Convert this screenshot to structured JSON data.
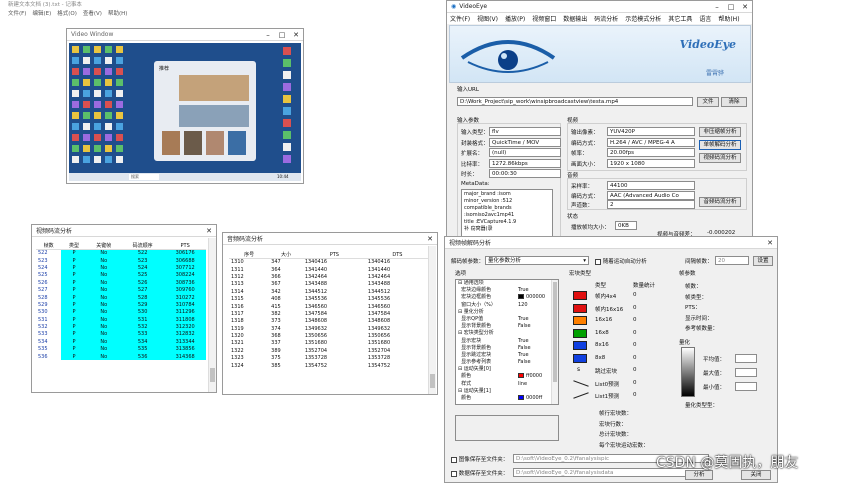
{
  "notepad": {
    "title": "新建文本文档 (3).txt - 记事本",
    "menus": [
      "文件(F)",
      "编辑(E)",
      "格式(O)",
      "查看(V)",
      "帮助(H)"
    ]
  },
  "video_window": {
    "title": "Video Window",
    "desktop_panel_title": "推荐",
    "taskbar_search": "搜索",
    "time": "10:44"
  },
  "stream_window": {
    "title": "视频码流分析",
    "headers": [
      "帧数",
      "类型",
      "关键帧",
      "码流顺序",
      "PTS"
    ],
    "rows": [
      [
        "522",
        "P",
        "No",
        "522",
        "306176"
      ],
      [
        "523",
        "P",
        "No",
        "523",
        "306688"
      ],
      [
        "524",
        "P",
        "No",
        "524",
        "307712"
      ],
      [
        "525",
        "P",
        "No",
        "525",
        "308224"
      ],
      [
        "526",
        "P",
        "No",
        "526",
        "308736"
      ],
      [
        "527",
        "P",
        "No",
        "527",
        "309760"
      ],
      [
        "528",
        "P",
        "No",
        "528",
        "310272"
      ],
      [
        "529",
        "P",
        "No",
        "529",
        "310784"
      ],
      [
        "530",
        "P",
        "No",
        "530",
        "311296"
      ],
      [
        "531",
        "P",
        "No",
        "531",
        "311808"
      ],
      [
        "532",
        "P",
        "No",
        "532",
        "312320"
      ],
      [
        "533",
        "P",
        "No",
        "533",
        "312832"
      ],
      [
        "534",
        "P",
        "No",
        "534",
        "313344"
      ],
      [
        "535",
        "P",
        "No",
        "535",
        "313856"
      ],
      [
        "536",
        "P",
        "No",
        "536",
        "314368"
      ]
    ]
  },
  "audio_window": {
    "title": "音频码流分析",
    "headers": [
      "序号",
      "大小",
      "PTS",
      "DTS"
    ],
    "rows": [
      [
        "1310",
        "347",
        "1340416",
        "1340416"
      ],
      [
        "1311",
        "364",
        "1341440",
        "1341440"
      ],
      [
        "1312",
        "366",
        "1342464",
        "1342464"
      ],
      [
        "1313",
        "367",
        "1343488",
        "1343488"
      ],
      [
        "1314",
        "342",
        "1344512",
        "1344512"
      ],
      [
        "1315",
        "408",
        "1345536",
        "1345536"
      ],
      [
        "1316",
        "415",
        "1346560",
        "1346560"
      ],
      [
        "1317",
        "382",
        "1347584",
        "1347584"
      ],
      [
        "1318",
        "373",
        "1348608",
        "1348608"
      ],
      [
        "1319",
        "374",
        "1349632",
        "1349632"
      ],
      [
        "1320",
        "368",
        "1350656",
        "1350656"
      ],
      [
        "1321",
        "337",
        "1351680",
        "1351680"
      ],
      [
        "1322",
        "389",
        "1352704",
        "1352704"
      ],
      [
        "1323",
        "375",
        "1353728",
        "1353728"
      ],
      [
        "1324",
        "385",
        "1354752",
        "1354752"
      ]
    ]
  },
  "videoeye": {
    "title": "VideoEye",
    "menus": [
      "文件(F)",
      "视图(V)",
      "播放(P)",
      "视频窗口",
      "数据输出",
      "码流分析",
      "示范模式分析",
      "其它工具",
      "语言",
      "帮助(H)"
    ],
    "brand": "VideoEye",
    "author": "雷霄骅",
    "url_label": "输入URL",
    "url_value": "D:\\Work_Project\\sip_work\\winsipbroadcastview\\testa.mp4",
    "file_btn": "文件",
    "clear_btn": "清除",
    "input_params_label": "输入参数",
    "input_fields": [
      {
        "label": "输入类型：",
        "value": "flv"
      },
      {
        "label": "封装格式：",
        "value": "QuickTime / MOV"
      },
      {
        "label": "扩展名：",
        "value": "(null)"
      },
      {
        "label": "比特率：",
        "value": "1272.86kbps"
      },
      {
        "label": "时长：",
        "value": "00:00:30"
      }
    ],
    "metadata_label": "MetaData:",
    "metadata_lines": [
      "major_brand :isom",
      "minor_version :512",
      "compatible_brands",
      ":isomiso2avc1mp41",
      "title :EVCapture4.1.9",
      "补  窃窝器(录"
    ],
    "video_label": "视频",
    "video_fields": [
      {
        "label": "输出像素：",
        "value": "YUV420P"
      },
      {
        "label": "编码方式：",
        "value": "H.264 / AVC / MPEG-4 A"
      },
      {
        "label": "帧率：",
        "value": "20.00fps"
      },
      {
        "label": "画面大小：",
        "value": "1920 x 1080"
      }
    ],
    "video_buttons": [
      "非压缩帧分析",
      "单帧解码分析",
      "视频码流分析"
    ],
    "audio_label": "音频",
    "audio_fields": [
      {
        "label": "采样率：",
        "value": "44100"
      },
      {
        "label": "编码方式：",
        "value": "AAC (Advanced Audio Co"
      },
      {
        "label": "声道数：",
        "value": "2"
      }
    ],
    "audio_button": "音频码流分析",
    "status_label": "状态",
    "status_fields": [
      {
        "label": "播放帧均大小：",
        "value": "0KB"
      },
      {
        "label": "音频帧均大小：",
        "value": "0KB"
      }
    ],
    "av_diff_label": "视频与音频差：",
    "av_diff_value": "-0.000202"
  },
  "decoder": {
    "title": "视频帧解码分析",
    "type_label": "解码帧参数：",
    "type_value": "量化参数分析",
    "auto_analysis_label": "随着运动自动分析",
    "interval_label": "间隔帧数：",
    "interval_value": "20",
    "set_btn": "设置",
    "options_label": "选项",
    "tree": [
      {
        "text": "⊟ 通用选项",
        "val": ""
      },
      {
        "text": "  宏块边缘颜色",
        "val": "True"
      },
      {
        "text": "  宏块边框颜色",
        "val": "000000"
      },
      {
        "text": "  窗口大小（%）",
        "val": "120"
      },
      {
        "text": "⊟ 量化分析",
        "val": ""
      },
      {
        "text": "  显示QP值",
        "val": "True"
      },
      {
        "text": "  显示背景颜色",
        "val": "False"
      },
      {
        "text": "⊟ 宏块类型分析",
        "val": ""
      },
      {
        "text": "  显示宏块",
        "val": "True"
      },
      {
        "text": "  显示背景颜色",
        "val": "False"
      },
      {
        "text": "  显示跳过宏块",
        "val": "True"
      },
      {
        "text": "  显示参考列表",
        "val": "False"
      },
      {
        "text": "⊟ 运动矢量[0]",
        "val": ""
      },
      {
        "text": "  颜色",
        "val": "ff0000"
      },
      {
        "text": "  样式",
        "val": "line"
      },
      {
        "text": "⊟ 运动矢量[1]",
        "val": ""
      },
      {
        "text": "  颜色",
        "val": "0000ff"
      }
    ],
    "mbtype_label": "宏块类型",
    "mbtype_headers": [
      "类型",
      "数量统计"
    ],
    "mbtypes": [
      {
        "name": "帧内4x4",
        "count": "0",
        "color": "#e01010"
      },
      {
        "name": "帧内16x16",
        "count": "0",
        "color": "#e01010"
      },
      {
        "name": "16x16",
        "count": "0",
        "color": "#ff8000"
      },
      {
        "name": "16x8",
        "count": "0",
        "color": "#00a000"
      },
      {
        "name": "8x16",
        "count": "0",
        "color": "#1040e0"
      },
      {
        "name": "8x8",
        "count": "0",
        "color": "#1040e0"
      },
      {
        "name": "跳过宏块",
        "count": "0",
        "color": ""
      },
      {
        "name": "List0预测",
        "count": "0",
        "color": ""
      },
      {
        "name": "List1预测",
        "count": "0",
        "color": ""
      }
    ],
    "stats": [
      "帧行宏块数：",
      "宏块行数：",
      "总计宏块数：",
      "每个宏块运动宏数："
    ],
    "frame_info_label": "帧参数",
    "frame_info": [
      "帧数：",
      "帧类型：",
      "PTS：",
      "显示时间：",
      "参考帧数量："
    ],
    "quant_label": "量化",
    "quant_stats": [
      "平均值：",
      "最大值：",
      "最小值："
    ],
    "quant_type_label": "量化类型型：",
    "save_labels": [
      "图像保存至文件夹：",
      "数据保存至文件夹："
    ],
    "save_paths": [
      "D:\\soft\\VideoEye_0.2\\ffanalysispic",
      "D:\\soft\\VideoEye_0.2\\ffanalysisdata"
    ],
    "analyze_btn": "分析",
    "close_btn": "关闭"
  },
  "watermark": "CSDN @莫固执，朋友"
}
